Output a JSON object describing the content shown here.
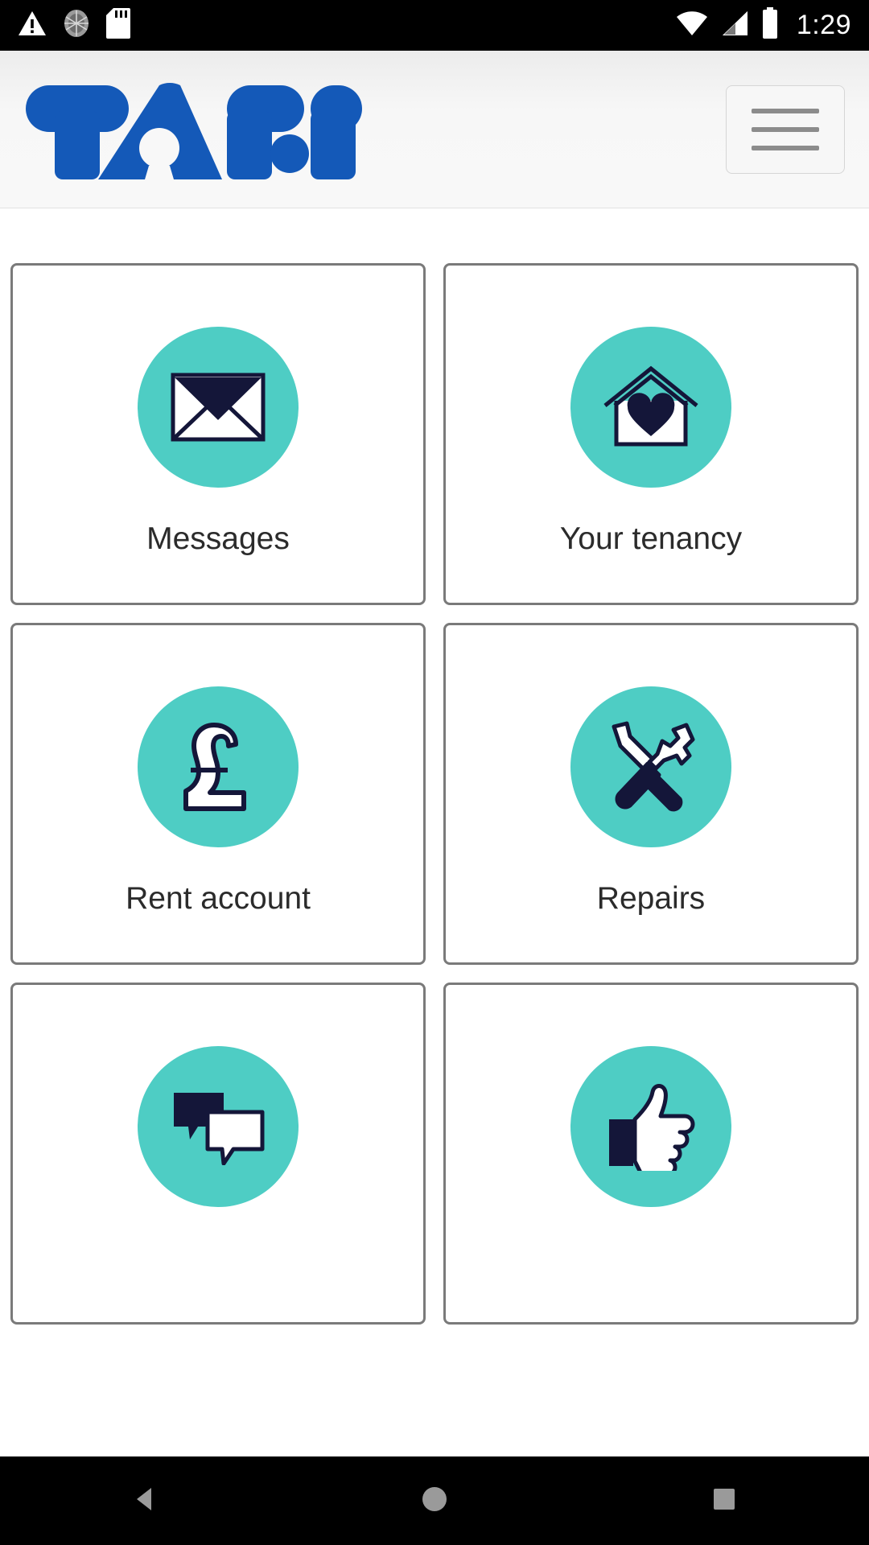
{
  "statusbar": {
    "time": "1:29",
    "left_icons": [
      "warning-triangle-icon",
      "sync-disc-icon",
      "sd-card-icon"
    ],
    "right_icons": [
      "wifi-icon",
      "cellular-signal-icon",
      "battery-icon"
    ]
  },
  "header": {
    "logo_text": "TAFF",
    "logo_color": "#1459b8",
    "menu_label": "menu"
  },
  "theme": {
    "icon_circle": "#4ecdc4",
    "icon_ink": "#141639",
    "tile_border": "#7a7a7a",
    "label_color": "#2b2b2b"
  },
  "tiles": [
    {
      "label": "Messages",
      "icon": "envelope-icon"
    },
    {
      "label": "Your tenancy",
      "icon": "house-heart-icon"
    },
    {
      "label": "Rent account",
      "icon": "pound-sterling-icon"
    },
    {
      "label": "Repairs",
      "icon": "tools-icon"
    },
    {
      "label": "",
      "icon": "speech-bubbles-icon"
    },
    {
      "label": "",
      "icon": "thumbs-up-icon"
    }
  ],
  "navbar": {
    "back_label": "Back",
    "home_label": "Home",
    "recents_label": "Recent apps"
  }
}
